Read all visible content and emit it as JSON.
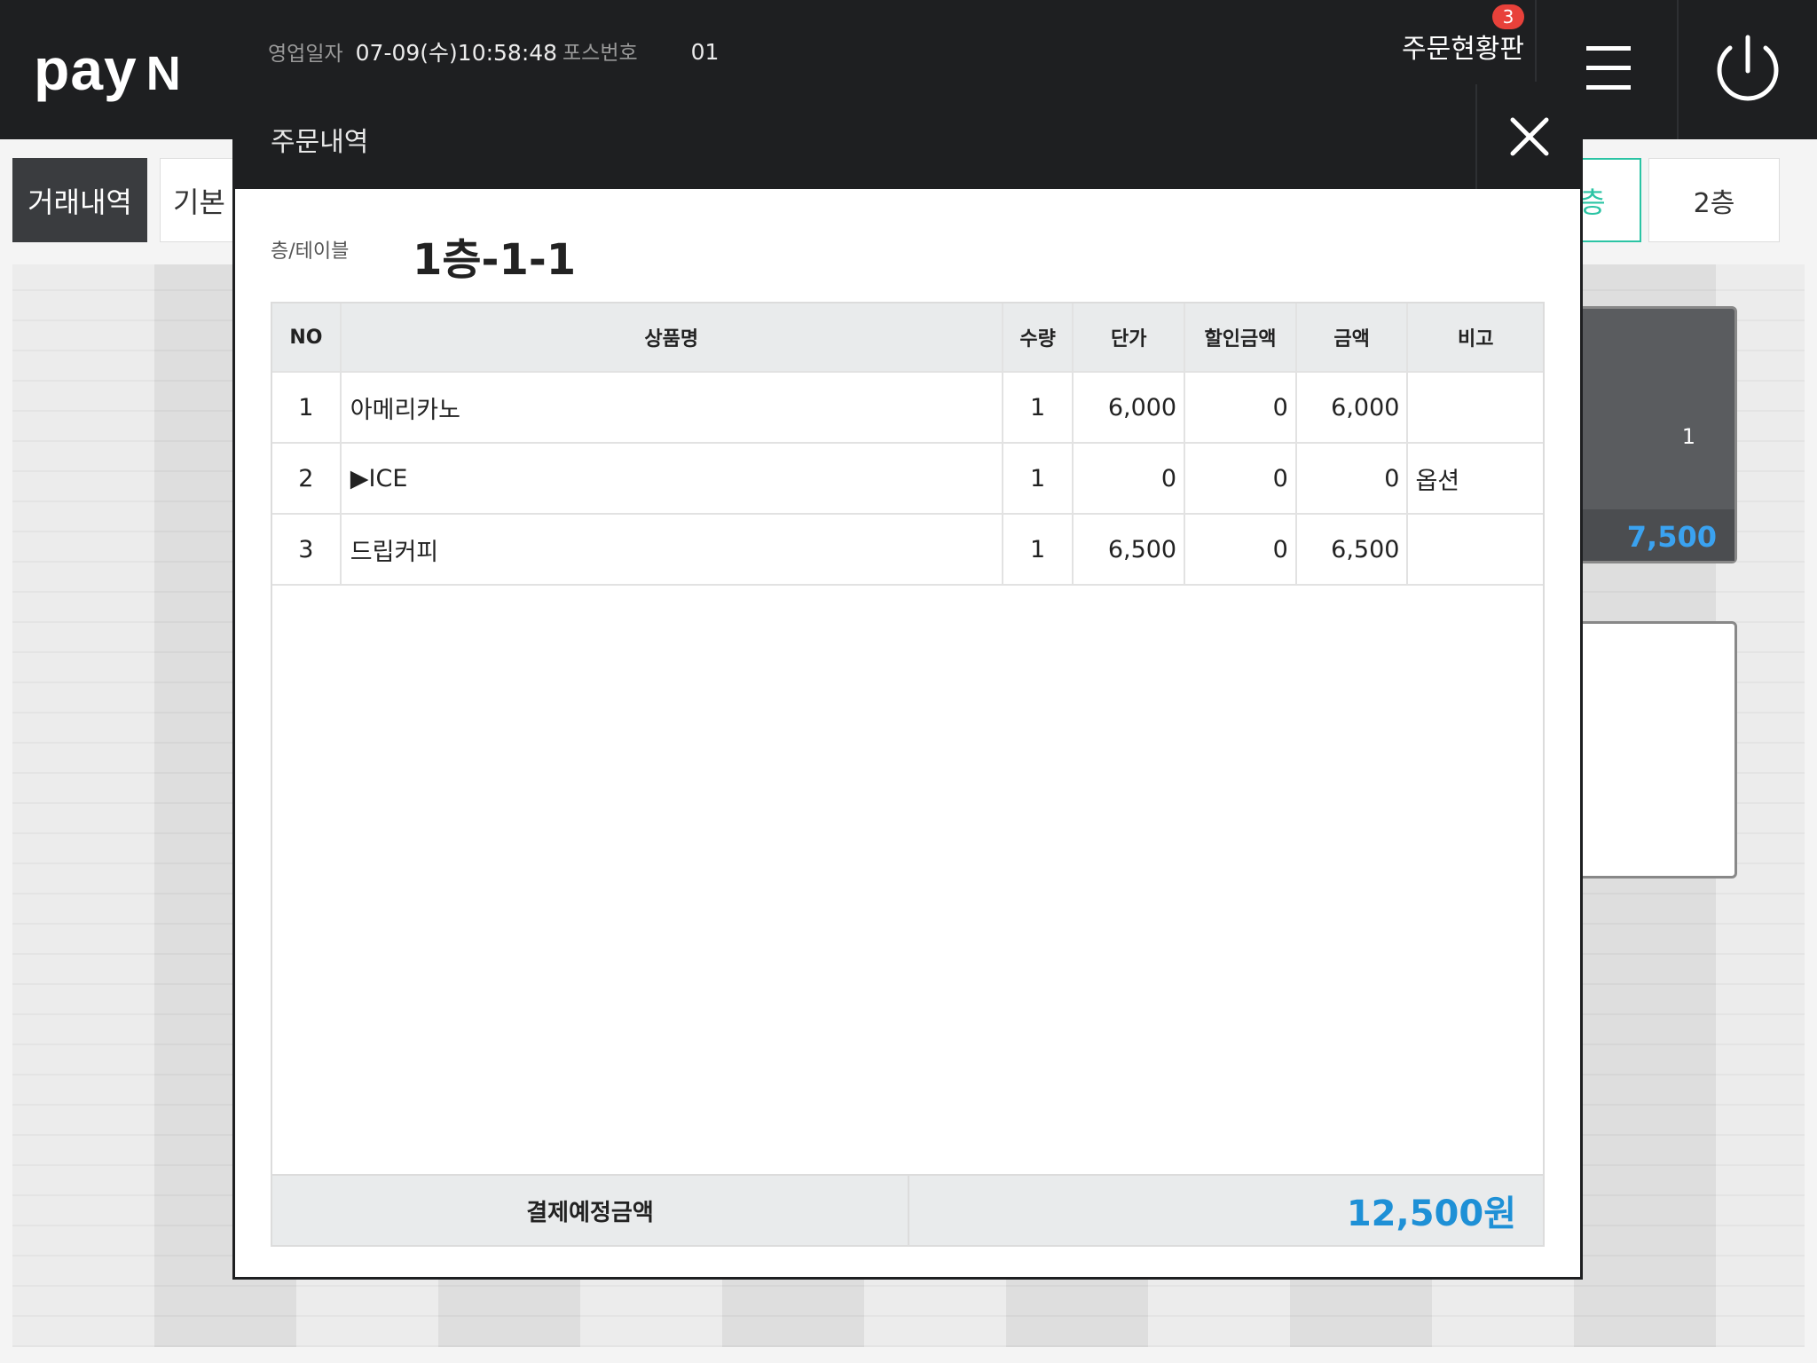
{
  "header": {
    "logo_main": "pay",
    "logo_n": "N",
    "business_date_label": "영업일자",
    "business_date_value": "07-09(수)10:58:48",
    "pos_number_label": "포스번호",
    "pos_number_value": "01",
    "order_status_label": "주문현황판",
    "order_status_badge": "3"
  },
  "background": {
    "tab_history": "거래내역",
    "tab_basic": "기본",
    "floor_active_partial": "층",
    "floor_2": "2층",
    "table1_number": "1",
    "table1_amount": "7,500"
  },
  "modal": {
    "title": "주문내역",
    "table_label": "층/테이블",
    "table_value": "1층-1-1",
    "columns": [
      "NO",
      "상품명",
      "수량",
      "단가",
      "할인금액",
      "금액",
      "비고"
    ],
    "rows": [
      {
        "no": "1",
        "name": "아메리카노",
        "qty": "1",
        "price": "6,000",
        "discount": "0",
        "amount": "6,000",
        "note": ""
      },
      {
        "no": "2",
        "name": "▶ICE",
        "qty": "1",
        "price": "0",
        "discount": "0",
        "amount": "0",
        "note": "옵션"
      },
      {
        "no": "3",
        "name": "드립커피",
        "qty": "1",
        "price": "6,500",
        "discount": "0",
        "amount": "6,500",
        "note": ""
      }
    ],
    "total_label": "결제예정금액",
    "total_value": "12,500원"
  },
  "colors": {
    "header_bg": "#1e1f21",
    "accent_blue": "#1e90d6",
    "accent_teal": "#2bc4a4",
    "badge_red": "#e8413a"
  }
}
